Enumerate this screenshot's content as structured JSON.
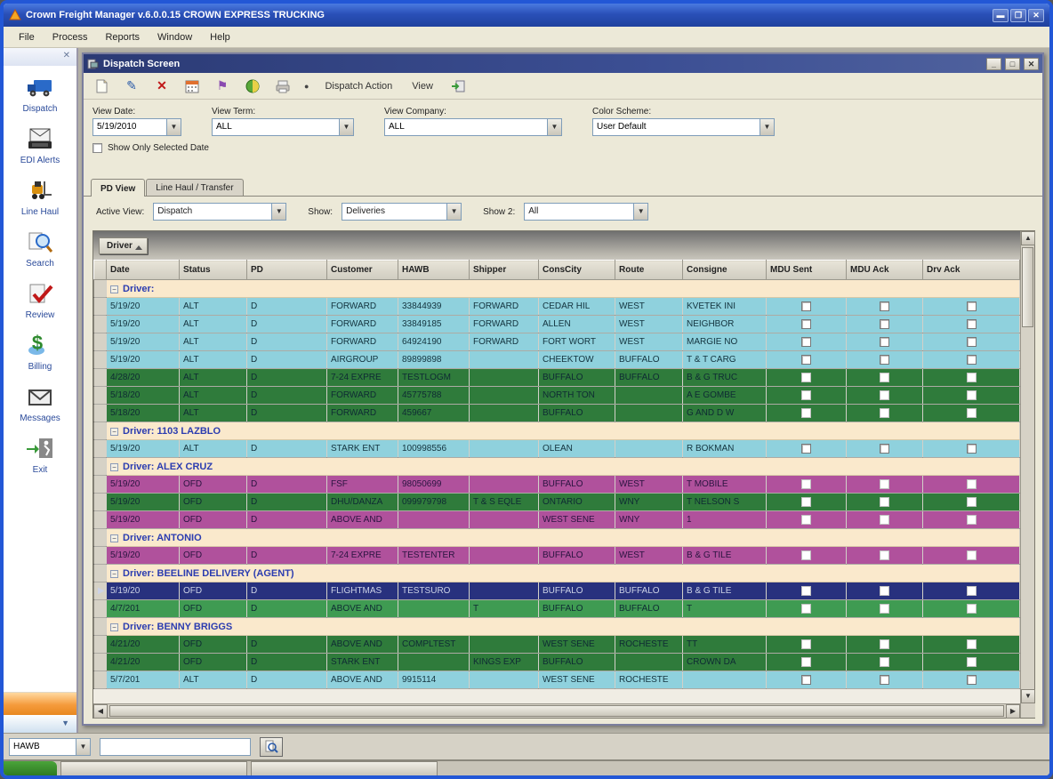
{
  "window": {
    "title": "Crown Freight Manager v.6.0.0.15 CROWN EXPRESS TRUCKING",
    "menu": [
      "File",
      "Process",
      "Reports",
      "Window",
      "Help"
    ],
    "buttons": {
      "minimize": "▬",
      "maximize": "❐",
      "close": "✕"
    }
  },
  "sidebar": {
    "close_glyph": "✕",
    "items": [
      {
        "label": "Dispatch",
        "icon": "truck-icon"
      },
      {
        "label": "EDI Alerts",
        "icon": "edi-envelope-icon"
      },
      {
        "label": "Line Haul",
        "icon": "forklift-icon"
      },
      {
        "label": "Search",
        "icon": "magnifier-icon"
      },
      {
        "label": "Review",
        "icon": "review-check-icon"
      },
      {
        "label": "Billing",
        "icon": "dollar-icon"
      },
      {
        "label": "Messages",
        "icon": "envelope-icon"
      },
      {
        "label": "Exit",
        "icon": "exit-icon"
      }
    ]
  },
  "dispatch_window": {
    "title": "Dispatch Screen",
    "buttons": {
      "minimize": "_",
      "maximize": "□",
      "close": "✕"
    },
    "toolbar": {
      "menus": [
        "Dispatch Action",
        "View"
      ]
    },
    "filters": {
      "view_date": {
        "label": "View Date:",
        "value": "5/19/2010"
      },
      "view_term": {
        "label": "View Term:",
        "value": "ALL"
      },
      "view_company": {
        "label": "View Company:",
        "value": "ALL"
      },
      "color_scheme": {
        "label": "Color Scheme:",
        "value": "User Default"
      },
      "show_only_selected_date": {
        "label": "Show Only Selected Date",
        "checked": false
      }
    },
    "tabs": [
      {
        "label": "PD View",
        "active": true
      },
      {
        "label": "Line Haul / Transfer",
        "active": false
      }
    ],
    "view_row": {
      "active_view": {
        "label": "Active View:",
        "value": "Dispatch"
      },
      "show": {
        "label": "Show:",
        "value": "Deliveries"
      },
      "show2": {
        "label": "Show 2:",
        "value": "All"
      }
    },
    "grid": {
      "group_by_label": "Driver",
      "columns": [
        "Date",
        "Status",
        "PD",
        "Customer",
        "HAWB",
        "Shipper",
        "ConsCity",
        "Route",
        "Consigne",
        "MDU Sent",
        "MDU Ack",
        "Drv Ack"
      ],
      "groups": [
        {
          "driver": "Driver:",
          "rows": [
            {
              "color": "blue",
              "cells": [
                "5/19/20",
                "ALT",
                "D",
                "FORWARD",
                "33844939",
                "FORWARD",
                "CEDAR HIL",
                "WEST",
                "KVETEK INI"
              ]
            },
            {
              "color": "blue",
              "cells": [
                "5/19/20",
                "ALT",
                "D",
                "FORWARD",
                "33849185",
                "FORWARD",
                "ALLEN",
                "WEST",
                "NEIGHBOR"
              ]
            },
            {
              "color": "blue",
              "cells": [
                "5/19/20",
                "ALT",
                "D",
                "FORWARD",
                "64924190",
                "FORWARD",
                "FORT WORT",
                "WEST",
                "MARGIE NO"
              ]
            },
            {
              "color": "blue",
              "cells": [
                "5/19/20",
                "ALT",
                "D",
                "AIRGROUP",
                "89899898",
                "",
                "CHEEKTOW",
                "BUFFALO",
                "T & T CARG"
              ]
            },
            {
              "color": "green",
              "cells": [
                "4/28/20",
                "ALT",
                "D",
                "7-24 EXPRE",
                "TESTLOGM",
                "",
                "BUFFALO",
                "BUFFALO",
                "B & G TRUC"
              ]
            },
            {
              "color": "green",
              "cells": [
                "5/18/20",
                "ALT",
                "D",
                "FORWARD",
                "45775788",
                "",
                "NORTH TON",
                "",
                "A E GOMBE"
              ]
            },
            {
              "color": "green",
              "cells": [
                "5/18/20",
                "ALT",
                "D",
                "FORWARD",
                "459667",
                "",
                "BUFFALO",
                "",
                "G AND D W"
              ]
            }
          ]
        },
        {
          "driver": "Driver: 1103 LAZBLO",
          "rows": [
            {
              "color": "blue",
              "cells": [
                "5/19/20",
                "ALT",
                "D",
                "STARK ENT",
                "100998556",
                "",
                "OLEAN",
                "",
                "R BOKMAN"
              ]
            }
          ]
        },
        {
          "driver": "Driver: ALEX CRUZ",
          "rows": [
            {
              "color": "magenta",
              "cells": [
                "5/19/20",
                "OFD",
                "D",
                "FSF",
                "98050699",
                "",
                "BUFFALO",
                "WEST",
                "T MOBILE"
              ]
            },
            {
              "color": "green",
              "cells": [
                "5/19/20",
                "OFD",
                "D",
                "DHU/DANZA",
                "099979798",
                "T & S EQLE",
                "ONTARIO",
                "WNY",
                "T NELSON S"
              ]
            },
            {
              "color": "magenta",
              "cells": [
                "5/19/20",
                "OFD",
                "D",
                "ABOVE AND",
                "",
                "",
                "WEST SENE",
                "WNY",
                "1"
              ]
            }
          ]
        },
        {
          "driver": "Driver: ANTONIO",
          "rows": [
            {
              "color": "magenta",
              "cells": [
                "5/19/20",
                "OFD",
                "D",
                "7-24 EXPRE",
                "TESTENTER",
                "",
                "BUFFALO",
                "WEST",
                "B & G TILE"
              ]
            }
          ]
        },
        {
          "driver": "Driver: BEELINE DELIVERY (AGENT)",
          "rows": [
            {
              "color": "navy",
              "selected": true,
              "cells": [
                "5/19/20",
                "OFD",
                "D",
                "FLIGHTMAS",
                "TESTSURO",
                "",
                "BUFFALO",
                "BUFFALO",
                "B & G TILE"
              ]
            },
            {
              "color": "midgreen",
              "cells": [
                "4/7/201",
                "OFD",
                "D",
                "ABOVE AND",
                "",
                "T",
                "BUFFALO",
                "BUFFALO",
                "T"
              ]
            }
          ]
        },
        {
          "driver": "Driver: BENNY BRIGGS",
          "rows": [
            {
              "color": "green",
              "cells": [
                "4/21/20",
                "OFD",
                "D",
                "ABOVE AND",
                "COMPLTEST",
                "",
                "WEST SENE",
                "ROCHESTE",
                "TT"
              ]
            },
            {
              "color": "green",
              "cells": [
                "4/21/20",
                "OFD",
                "D",
                "STARK ENT",
                "",
                "KINGS EXP",
                "BUFFALO",
                "",
                "CROWN DA"
              ]
            },
            {
              "color": "blue",
              "cells": [
                "5/7/201",
                "ALT",
                "D",
                "ABOVE AND",
                "9915114",
                "",
                "WEST SENE",
                "ROCHESTE",
                ""
              ]
            }
          ]
        }
      ]
    },
    "quick_search": {
      "field": "HAWB",
      "value": ""
    }
  },
  "colors": {
    "frame_blue": "#2257D6",
    "row_blue": "#8FD1DD",
    "row_green": "#2F7B3B",
    "row_magenta": "#B0519C",
    "row_navy": "#28317E",
    "row_midgreen": "#3F9B52",
    "group_row_bg": "#FAE9CC"
  }
}
